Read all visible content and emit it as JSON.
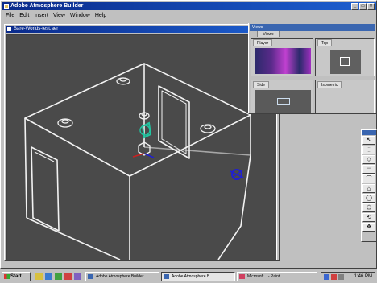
{
  "app": {
    "title": "Adobe Atmosphere Builder",
    "menu": [
      "File",
      "Edit",
      "Insert",
      "View",
      "Window",
      "Help"
    ]
  },
  "document": {
    "title": "Bare-Worlds-test.aer"
  },
  "views_panel": {
    "title": "Views",
    "tab": "Views",
    "cells": [
      "Player",
      "Top",
      "Side",
      "Isometric"
    ]
  },
  "tools": [
    "↖",
    "⬚",
    "◇",
    "▭",
    "⌒",
    "△",
    "◯",
    "⬠",
    "⟲",
    "✥"
  ],
  "taskbar": {
    "start_label": "Start",
    "tasks": [
      "Adobe Atmosphere Builder",
      "Adobe Atmosphere B...",
      "Microsoft ...- Paint"
    ],
    "clock": "1:46 PM"
  },
  "colors": {
    "title_active": "#0a2a8a",
    "viewport_bg": "#4a4a4a",
    "wireframe": "#f2f2f2",
    "gizmo_green": "#21c4a0",
    "gizmo_blue": "#2020d0",
    "gizmo_red": "#cc2020"
  }
}
